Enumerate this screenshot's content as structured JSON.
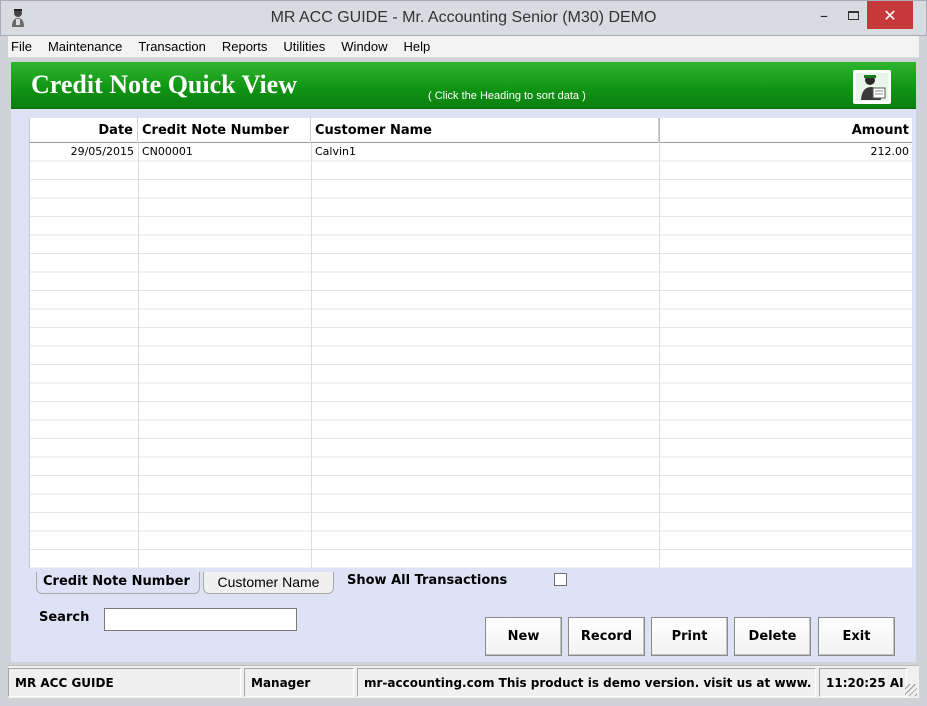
{
  "window": {
    "title": "MR ACC GUIDE - Mr. Accounting Senior (M30) DEMO",
    "minimize": "–",
    "close": "✕"
  },
  "menu": [
    {
      "label": "File"
    },
    {
      "label": "Maintenance"
    },
    {
      "label": "Transaction"
    },
    {
      "label": "Reports"
    },
    {
      "label": "Utilities"
    },
    {
      "label": "Window"
    },
    {
      "label": "Help"
    }
  ],
  "header": {
    "title": "Credit Note Quick View",
    "hint": "( Click the Heading to sort data )",
    "icon": "accountant-icon"
  },
  "table": {
    "columns": [
      "Date",
      "Credit Note Number",
      "Customer Name",
      "Amount"
    ],
    "rows": [
      {
        "date": "29/05/2015",
        "credit_note_number": "CN00001",
        "customer_name": "Calvin1",
        "amount": "212.00"
      }
    ]
  },
  "sort_tabs": {
    "credit_note_number": "Credit Note Number",
    "customer_name": "Customer Name"
  },
  "show_all": {
    "label": "Show All Transactions",
    "checked": false
  },
  "search": {
    "label": "Search",
    "value": ""
  },
  "buttons": {
    "new": "New",
    "record": "Record",
    "print": "Print",
    "delete": "Delete",
    "exit": "Exit"
  },
  "status": {
    "app": "MR ACC GUIDE",
    "user": "Manager",
    "message": "mr-accounting.com This product is demo version.  visit us at www.",
    "time": "11:20:25 AI"
  },
  "colors": {
    "header_green": "#0f9313",
    "panel": "#dde2f5",
    "close_button": "#c7383a"
  }
}
